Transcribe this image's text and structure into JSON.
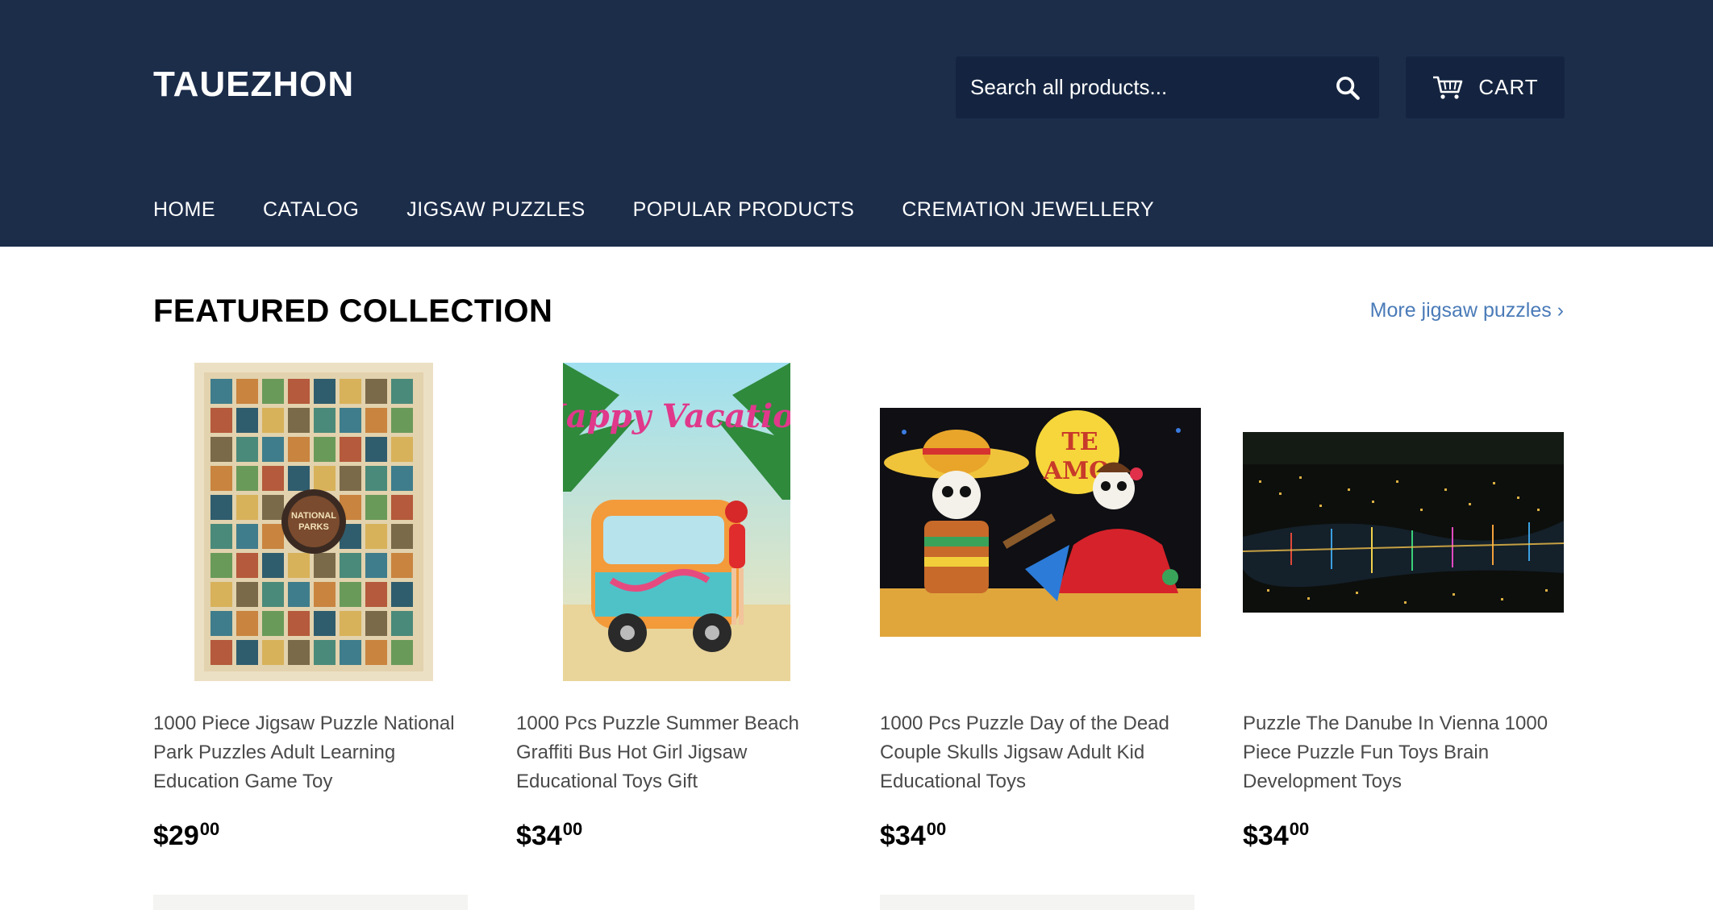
{
  "store": {
    "name": "TAUEZHON"
  },
  "search": {
    "placeholder": "Search all products..."
  },
  "cart": {
    "label": "CART"
  },
  "nav": {
    "items": [
      {
        "label": "HOME"
      },
      {
        "label": "CATALOG"
      },
      {
        "label": "JIGSAW PUZZLES"
      },
      {
        "label": "POPULAR PRODUCTS"
      },
      {
        "label": "CREMATION JEWELLERY"
      }
    ]
  },
  "featured": {
    "title": "FEATURED COLLECTION",
    "more_link": "More jigsaw puzzles ›",
    "products": [
      {
        "title": "1000 Piece Jigsaw Puzzle National Park Puzzles Adult Learning Education Game Toy",
        "price_dollars": "$29",
        "price_cents": "00"
      },
      {
        "title": "1000 Pcs Puzzle Summer Beach Graffiti Bus Hot Girl Jigsaw Educational Toys Gift",
        "price_dollars": "$34",
        "price_cents": "00"
      },
      {
        "title": "1000 Pcs Puzzle Day of the Dead Couple Skulls Jigsaw Adult Kid Educational Toys",
        "price_dollars": "$34",
        "price_cents": "00"
      },
      {
        "title": "Puzzle The Danube In Vienna 1000 Piece Puzzle Fun Toys Brain Development Toys",
        "price_dollars": "$34",
        "price_cents": "00"
      }
    ]
  },
  "colors": {
    "header_bg": "#1c2d4a",
    "search_bg": "#142440",
    "link": "#4a7bb8"
  }
}
